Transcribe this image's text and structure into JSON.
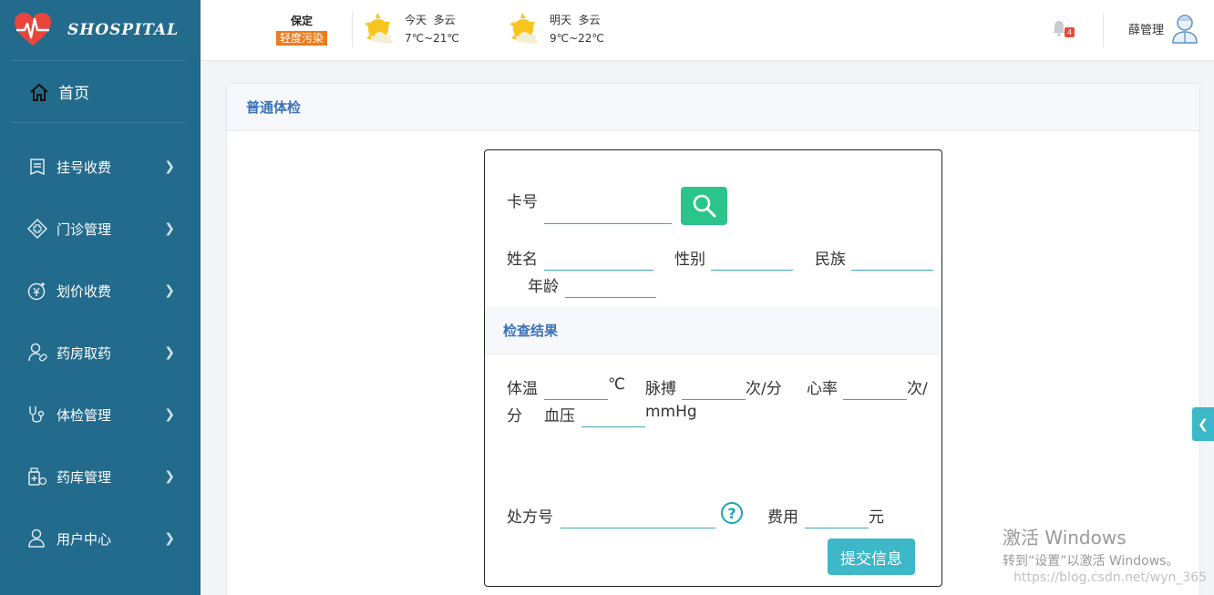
{
  "sidebar": {
    "logo_text": "SHOSPITAL",
    "home_label": "首页",
    "items": [
      {
        "label": "挂号收费",
        "icon": "register-icon"
      },
      {
        "label": "门诊管理",
        "icon": "clinic-icon"
      },
      {
        "label": "划价收费",
        "icon": "yen-icon"
      },
      {
        "label": "药房取药",
        "icon": "pharmacy-icon"
      },
      {
        "label": "体检管理",
        "icon": "stethoscope-icon"
      },
      {
        "label": "药库管理",
        "icon": "medicine-store-icon"
      },
      {
        "label": "用户中心",
        "icon": "user-icon"
      }
    ]
  },
  "header": {
    "city": "保定",
    "air_quality": "轻度污染",
    "today": {
      "day": "今天",
      "cond": "多云",
      "temp": "7℃~21℃"
    },
    "tomorrow": {
      "day": "明天",
      "cond": "多云",
      "temp": "9℃~22℃"
    },
    "notification_count": "4",
    "user_name": "薛管理"
  },
  "panel": {
    "title": "普通体检",
    "card_label": "卡号",
    "name_label": "姓名",
    "gender_label": "性别",
    "ethnicity_label": "民族",
    "age_label": "年龄",
    "section_title": "检查结果",
    "temp_label": "体温",
    "temp_unit": "℃",
    "pulse_label": "脉搏",
    "pulse_unit": "次/分",
    "heart_label": "心率",
    "heart_unit_a": "次/",
    "heart_unit_b": "分",
    "bp_label": "血压",
    "bp_unit": "mmHg",
    "rx_label": "处方号",
    "fee_label": "费用",
    "fee_unit": "元",
    "submit_label": "提交信息"
  },
  "watermark": {
    "line1": "激活 Windows",
    "line2": "转到“设置”以激活 Windows。",
    "url": "https://blog.csdn.net/wyn_365"
  },
  "colors": {
    "sidebar_bg": "#226b8c",
    "accent": "#3cb8c8",
    "search_btn": "#2bc48b",
    "title_blue": "#3d73b8"
  }
}
